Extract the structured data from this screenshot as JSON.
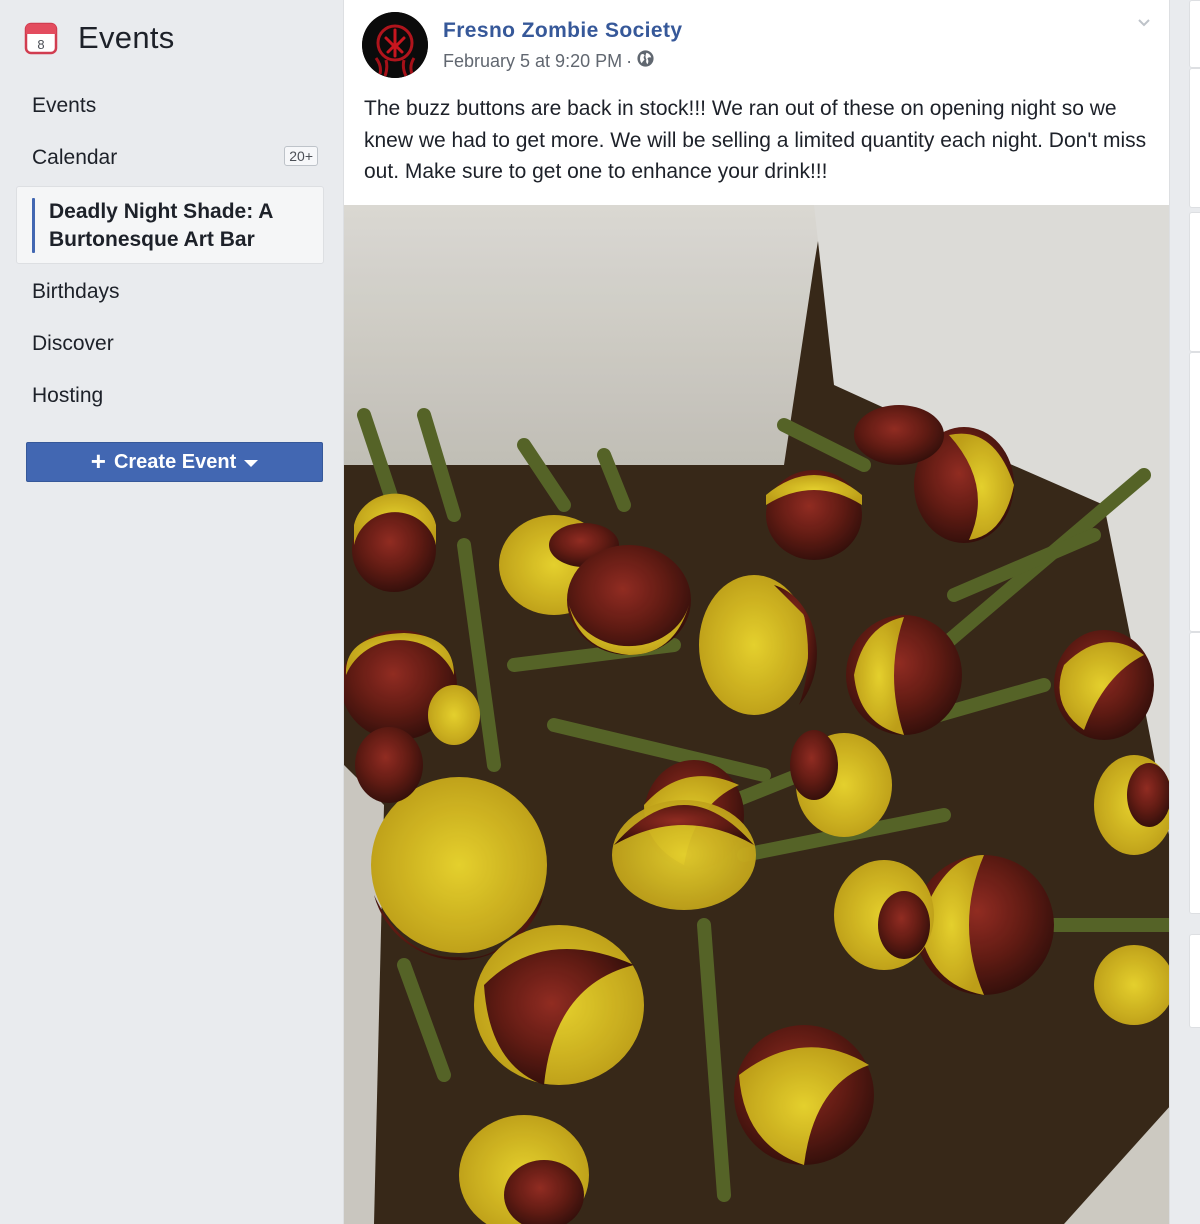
{
  "sidebar": {
    "icon": "calendar-icon",
    "calendar_day": "8",
    "title": "Events",
    "items": [
      {
        "label": "Events"
      },
      {
        "label": "Calendar",
        "badge": "20+"
      },
      {
        "label": "Deadly Night Shade: A Burtonesque Art Bar",
        "active": true
      },
      {
        "label": "Birthdays"
      },
      {
        "label": "Discover"
      },
      {
        "label": "Hosting"
      }
    ],
    "create_button": {
      "plus": "+",
      "label": "Create Event"
    }
  },
  "post": {
    "author": "Fresno Zombie Society",
    "timestamp": "February 5 at 9:20 PM",
    "separator": "·",
    "privacy_icon": "globe-icon",
    "text": "The buzz buttons are back in stock!!! We ran out of these on opening night so we knew we had to get more. We will be selling a limited quantity each night. Don't miss out. Make sure to get one to enhance your drink!!!",
    "photo_subject": "buzz-button-flowers-photo"
  },
  "colors": {
    "brand_blue": "#4267b2",
    "link_blue": "#365899",
    "page_bg": "#e9ebee"
  }
}
